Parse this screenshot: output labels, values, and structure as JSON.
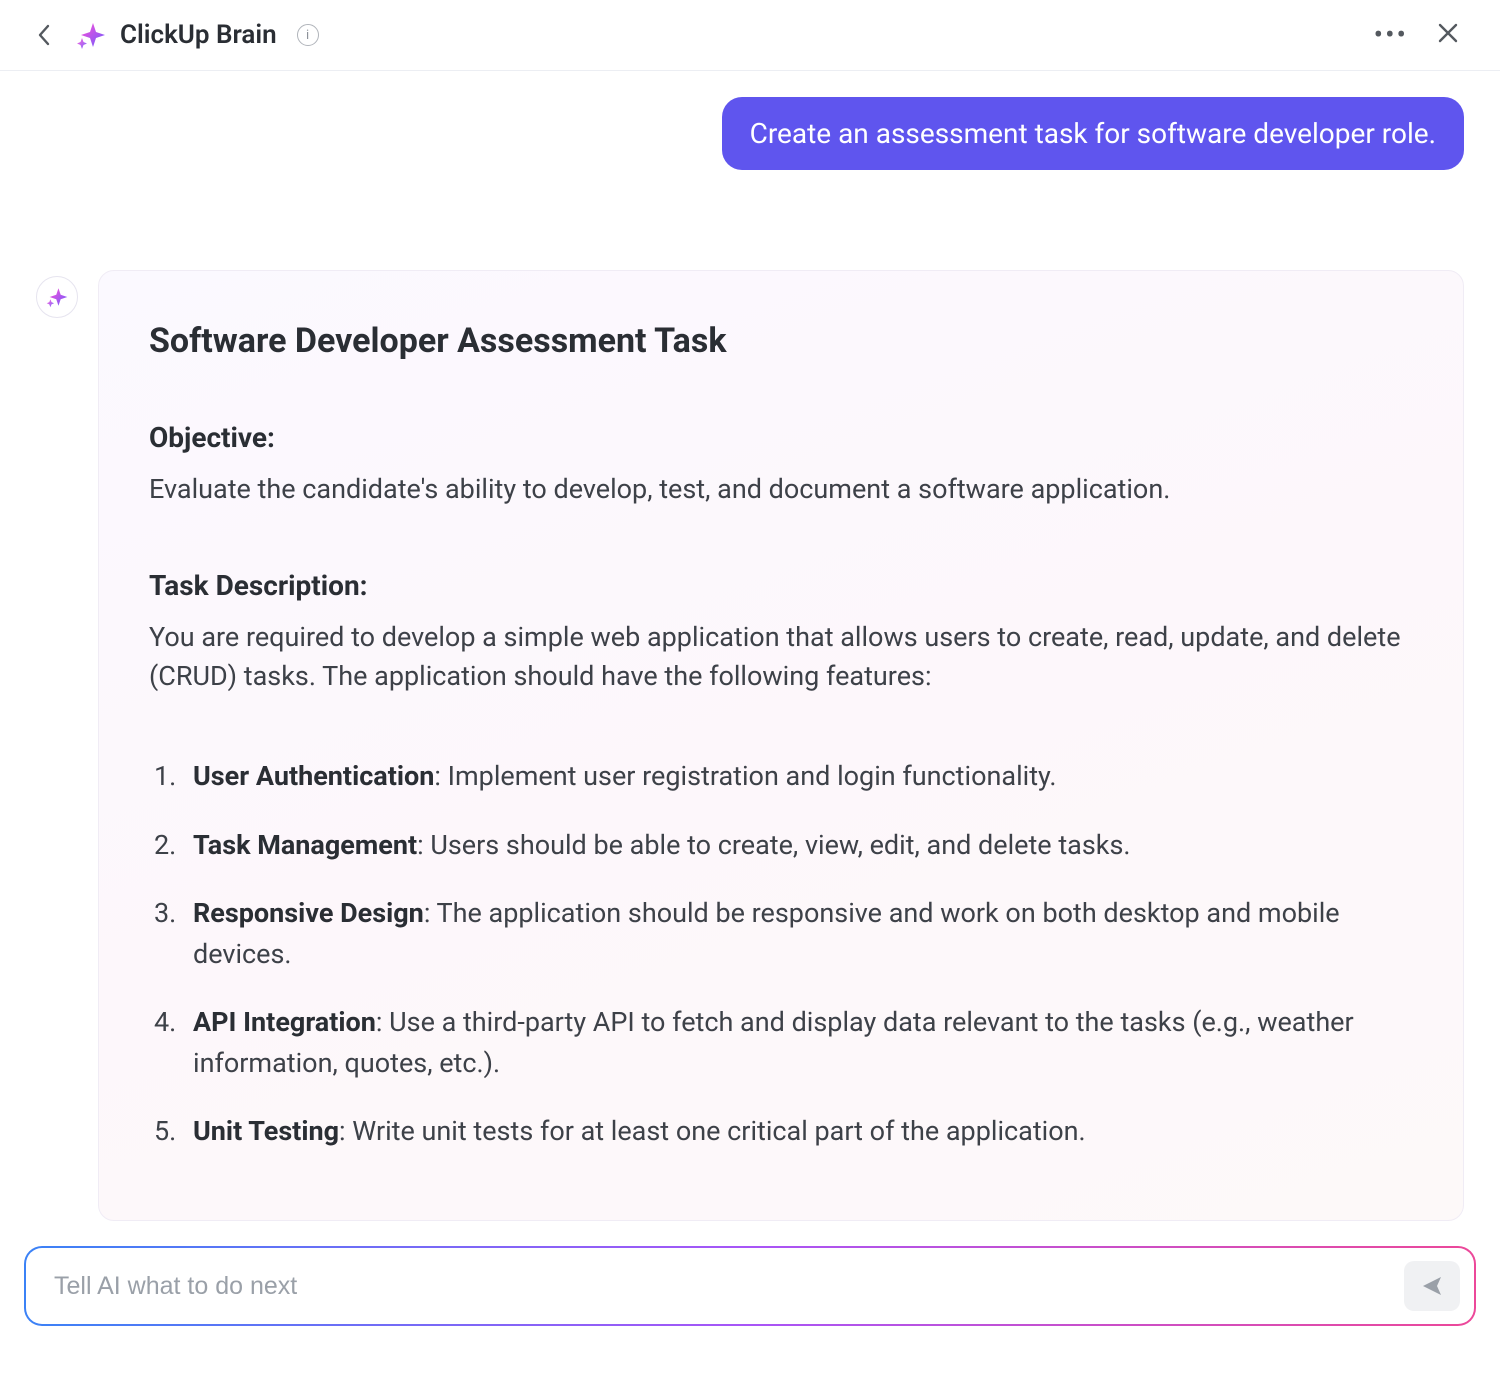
{
  "header": {
    "title": "ClickUp Brain"
  },
  "conversation": {
    "user_prompt": "Create an assessment task for software developer role.",
    "ai": {
      "title": "Software Developer Assessment Task",
      "objective_heading": "Objective:",
      "objective_body": "Evaluate the candidate's ability to develop, test, and document a software application.",
      "taskdesc_heading": "Task Description:",
      "taskdesc_body": "You are required to develop a simple web application that allows users to create, read, update, and delete (CRUD) tasks. The application should have the following features:",
      "features": [
        {
          "label": "User Authentication",
          "text": ": Implement user registration and login functionality."
        },
        {
          "label": "Task Management",
          "text": ": Users should be able to create, view, edit, and delete tasks."
        },
        {
          "label": "Responsive Design",
          "text": ": The application should be responsive and work on both desktop and mobile devices."
        },
        {
          "label": "API Integration",
          "text": ": Use a third-party API to fetch and display data relevant to the tasks (e.g., weather information, quotes, etc.)."
        },
        {
          "label": "Unit Testing",
          "text": ": Write unit tests for at least one critical part of the application."
        }
      ]
    }
  },
  "input": {
    "placeholder": "Tell AI what to do next"
  }
}
